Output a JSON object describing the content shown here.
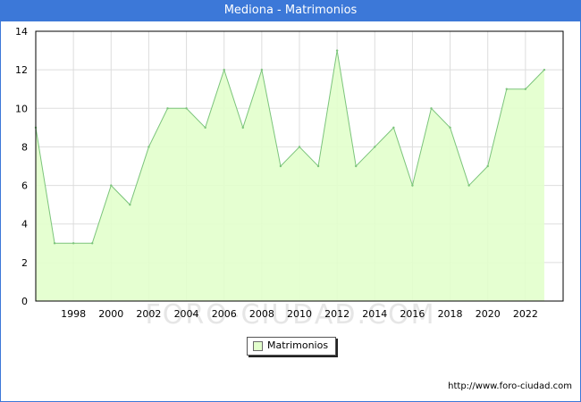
{
  "header": {
    "title": "Mediona - Matrimonios"
  },
  "legend": {
    "label": "Matrimonios"
  },
  "footer": {
    "url": "http://www.foro-ciudad.com"
  },
  "watermark": "FORO-CIUDAD.COM",
  "colors": {
    "title_bar": "#3c78d8",
    "area_fill": "#e2ffcc",
    "line": "#7bc47b",
    "grid": "#dddddd"
  },
  "chart_data": {
    "type": "area",
    "title": "Mediona - Matrimonios",
    "x": [
      1996,
      1997,
      1998,
      1999,
      2000,
      2001,
      2002,
      2003,
      2004,
      2005,
      2006,
      2007,
      2008,
      2009,
      2010,
      2011,
      2012,
      2013,
      2014,
      2015,
      2016,
      2017,
      2018,
      2019,
      2020,
      2021,
      2022,
      2023
    ],
    "series": [
      {
        "name": "Matrimonios",
        "values": [
          9,
          3,
          3,
          3,
          6,
          5,
          8,
          10,
          10,
          9,
          12,
          9,
          12,
          7,
          8,
          7,
          13,
          7,
          8,
          9,
          6,
          10,
          9,
          6,
          7,
          11,
          11,
          12
        ]
      }
    ],
    "x_ticks": [
      1998,
      2000,
      2002,
      2004,
      2006,
      2008,
      2010,
      2012,
      2014,
      2016,
      2018,
      2020,
      2022
    ],
    "y_ticks": [
      0,
      2,
      4,
      6,
      8,
      10,
      12,
      14
    ],
    "xlim": [
      1996,
      2024
    ],
    "ylim": [
      0,
      14
    ],
    "grid": true,
    "legend_position": "bottom-center"
  }
}
